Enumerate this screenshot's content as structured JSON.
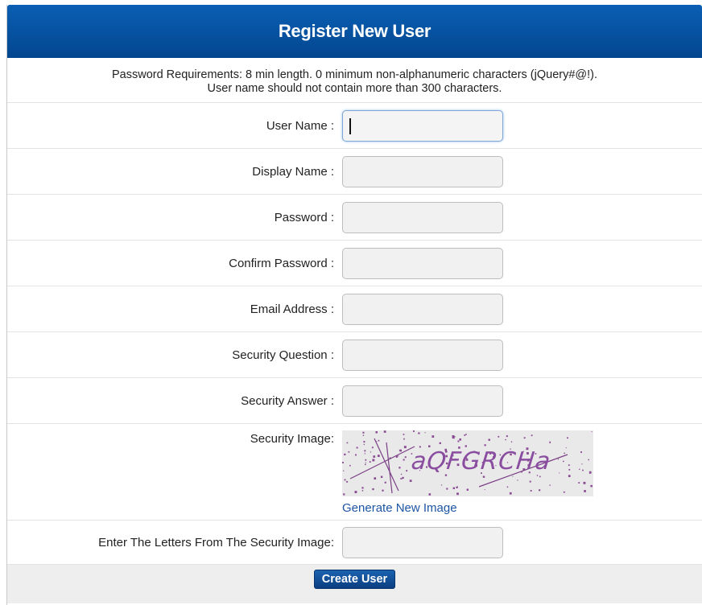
{
  "header": {
    "title": "Register New User"
  },
  "requirements": {
    "line1": "Password Requirements: 8 min length. 0 minimum non-alphanumeric characters (jQuery#@!).",
    "line2": "User name should not contain more than 300 characters."
  },
  "fields": [
    {
      "label": "User Name :",
      "value": "",
      "focused": true
    },
    {
      "label": "Display Name :",
      "value": ""
    },
    {
      "label": "Password :",
      "value": ""
    },
    {
      "label": "Confirm Password :",
      "value": ""
    },
    {
      "label": "Email Address :",
      "value": ""
    },
    {
      "label": "Security Question :",
      "value": ""
    },
    {
      "label": "Security Answer :",
      "value": ""
    }
  ],
  "captcha": {
    "label": "Security Image:",
    "image_text": "aQFGRCHa",
    "generate_link": "Generate New Image"
  },
  "letters": {
    "label": "Enter The Letters From The Security Image:",
    "value": ""
  },
  "footer": {
    "create_button": "Create User"
  },
  "colors": {
    "header": "#0a5fb4",
    "link": "#1d55a3",
    "button": "#0b3e80",
    "captcha_ink": "#7b3f86"
  }
}
